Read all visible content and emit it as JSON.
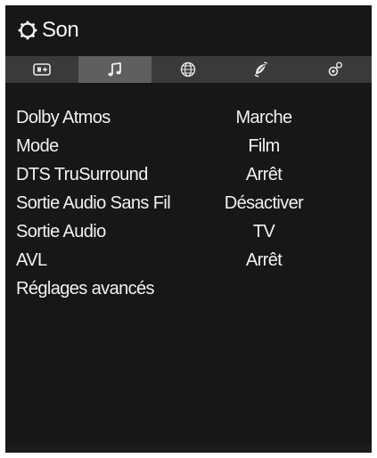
{
  "menu": {
    "title": "Son",
    "title_icon": "gear-icon"
  },
  "tabs": [
    {
      "name": "picture",
      "icon": "picture-icon",
      "active": false
    },
    {
      "name": "sound",
      "icon": "music-note-icon",
      "active": true
    },
    {
      "name": "network",
      "icon": "globe-icon",
      "active": false
    },
    {
      "name": "installation",
      "icon": "satellite-dish-icon",
      "active": false
    },
    {
      "name": "system",
      "icon": "settings-icon",
      "active": false
    }
  ],
  "settings": [
    {
      "label": "Dolby Atmos",
      "value": "Marche"
    },
    {
      "label": "Mode",
      "value": "Film"
    },
    {
      "label": "DTS TruSurround",
      "value": "Arrêt"
    },
    {
      "label": "Sortie Audio Sans Fil",
      "value": "Désactiver"
    },
    {
      "label": "Sortie Audio",
      "value": "TV"
    },
    {
      "label": "AVL",
      "value": "Arrêt"
    },
    {
      "label": "Réglages avancés",
      "value": ""
    }
  ],
  "colors": {
    "background": "#171717",
    "tab_bar": "#3a3a3a",
    "tab_active": "#5f5f5f",
    "text": "#f2f2f2"
  }
}
